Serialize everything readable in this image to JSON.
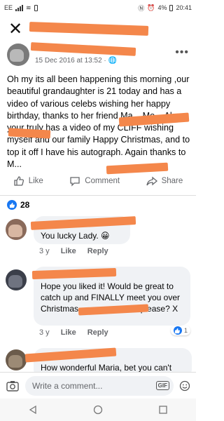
{
  "status": {
    "carrier": "EE",
    "right": "N ⏰ ∦ 4% ▯ 20:41",
    "time": "20:41",
    "battery": "4%"
  },
  "post": {
    "meta": "15 Dec 2016 at 13:52 · ",
    "body": "Oh my its all been happening  this morning ,our beautiful  grandaughter  is 21 today and has a video  of various  celebs wishing her happy birthday, thanks to her friend Ma... Mo... Also your truly has a video  of my CLIFF wishing  myself  and our family Happy Christmas, and to top it off I have his autograph. Again  thanks  to M..."
  },
  "actions": {
    "like": "Like",
    "comment": "Comment",
    "share": "Share"
  },
  "reactions": {
    "count": "28"
  },
  "comments": [
    {
      "text": "You lucky Lady. 😀",
      "time": "3 y",
      "like": "Like",
      "reply": "Reply"
    },
    {
      "text": "Hope you liked it! Would be great to catch up and FINALLY meet you over Christmas. ... can you sort please? X",
      "time": "3 y",
      "like": "Like",
      "reply": "Reply",
      "reactions": "1"
    },
    {
      "text": "How wonderful Maria, bet you can't"
    }
  ],
  "composer": {
    "placeholder": "Write a comment...",
    "gif": "GIF"
  }
}
